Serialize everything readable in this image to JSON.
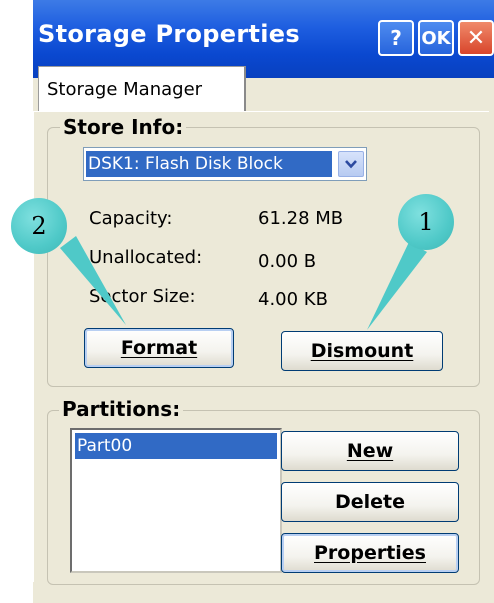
{
  "window": {
    "title": "Storage Properties",
    "help_label": "?",
    "ok_label": "OK",
    "close_label": "✕"
  },
  "tabs": [
    {
      "label": "Storage Manager",
      "selected": true
    }
  ],
  "store_info": {
    "group_label": "Store Info:",
    "selected_store": "DSK1: Flash Disk Block",
    "fields": [
      {
        "label": "Capacity:",
        "value": "61.28 MB"
      },
      {
        "label": "Unallocated:",
        "value": "0.00 B"
      },
      {
        "label": "Sector Size:",
        "value": "4.00 KB"
      }
    ],
    "format_label": "Format",
    "dismount_label": "Dismount"
  },
  "partitions": {
    "group_label": "Partitions:",
    "items": [
      "Part00"
    ],
    "new_label": "New",
    "delete_label": "Delete",
    "properties_label": "Properties"
  },
  "callouts": [
    {
      "number": "2",
      "target": "format-button"
    },
    {
      "number": "1",
      "target": "dismount-button"
    }
  ],
  "colors": {
    "titlebar": "#0a48d0",
    "selection": "#316ac5",
    "callout": "#4fc9c8",
    "dialog_bg": "#ece9d8"
  }
}
